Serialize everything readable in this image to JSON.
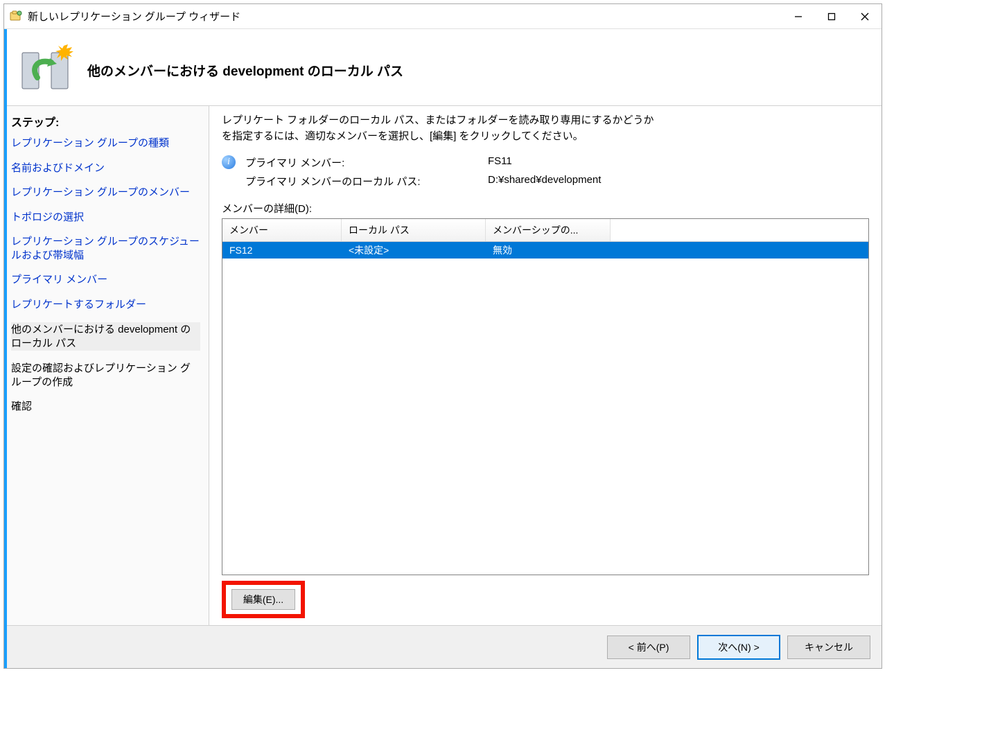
{
  "window": {
    "title": "新しいレプリケーション グループ ウィザード"
  },
  "header": {
    "title": "他のメンバーにおける development のローカル パス"
  },
  "sidebar": {
    "heading": "ステップ:",
    "steps": [
      {
        "label": "レプリケーション グループの種類",
        "state": "link"
      },
      {
        "label": "名前およびドメイン",
        "state": "link"
      },
      {
        "label": "レプリケーション グループのメンバー",
        "state": "link"
      },
      {
        "label": "トポロジの選択",
        "state": "link"
      },
      {
        "label": "レプリケーション グループのスケジュールおよび帯域幅",
        "state": "link"
      },
      {
        "label": "プライマリ メンバー",
        "state": "link"
      },
      {
        "label": "レプリケートするフォルダー",
        "state": "link"
      },
      {
        "label": "他のメンバーにおける development のローカル パス",
        "state": "current"
      },
      {
        "label": "設定の確認およびレプリケーション グループの作成",
        "state": "upcoming"
      },
      {
        "label": "確認",
        "state": "upcoming"
      }
    ]
  },
  "content": {
    "description": "レプリケート フォルダーのローカル パス、またはフォルダーを読み取り専用にするかどうか\nを指定するには、適切なメンバーを選択し、[編集] をクリックしてください。",
    "primary_member_label": "プライマリ メンバー:",
    "primary_member_value": "FS11",
    "primary_path_label": "プライマリ メンバーのローカル パス:",
    "primary_path_value": "D:¥shared¥development",
    "member_detail_label": "メンバーの詳細(D):",
    "columns": {
      "member": "メンバー",
      "local_path": "ローカル パス",
      "membership": "メンバーシップの..."
    },
    "rows": [
      {
        "member": "FS12",
        "local_path": "<未設定>",
        "membership": "無効",
        "selected": true
      }
    ],
    "edit_label": "編集(E)..."
  },
  "footer": {
    "back": "< 前へ(P)",
    "next": "次へ(N) >",
    "cancel": "キャンセル"
  }
}
